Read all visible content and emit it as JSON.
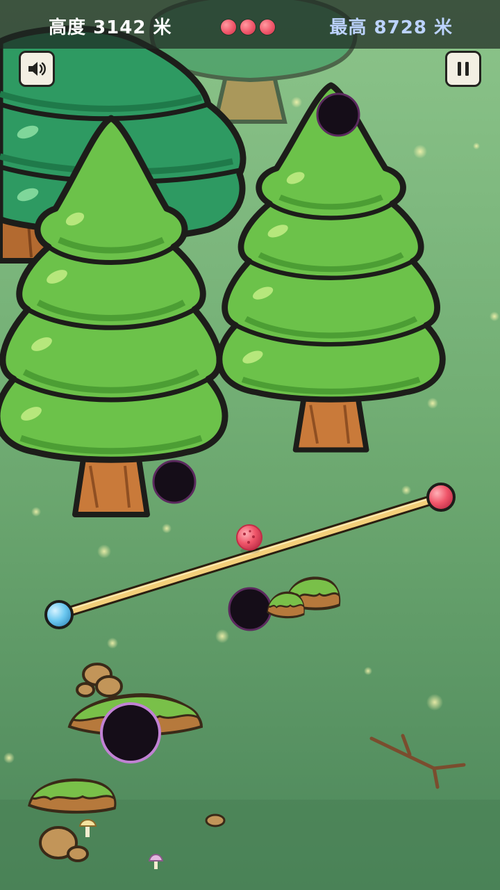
{
  "hud": {
    "height_label": "高度",
    "height_value": "3142",
    "height_unit": "米",
    "best_label": "最高",
    "best_value": "8728",
    "best_unit": "米",
    "lives": 3
  },
  "controls": {
    "sound_icon": "speaker-icon",
    "pause_icon": "pause-icon"
  },
  "colors": {
    "grass_top": "#86c086",
    "grass_bottom": "#4f8a5a",
    "tree_foliage": "#6cc24a",
    "tree_foliage_dark": "#2e8f5a",
    "trunk": "#c97a3a",
    "rope": "#f3cf7a",
    "ball_pink": "#f0566a",
    "ball_blue": "#6cc8f0",
    "hole": "#150d18"
  }
}
